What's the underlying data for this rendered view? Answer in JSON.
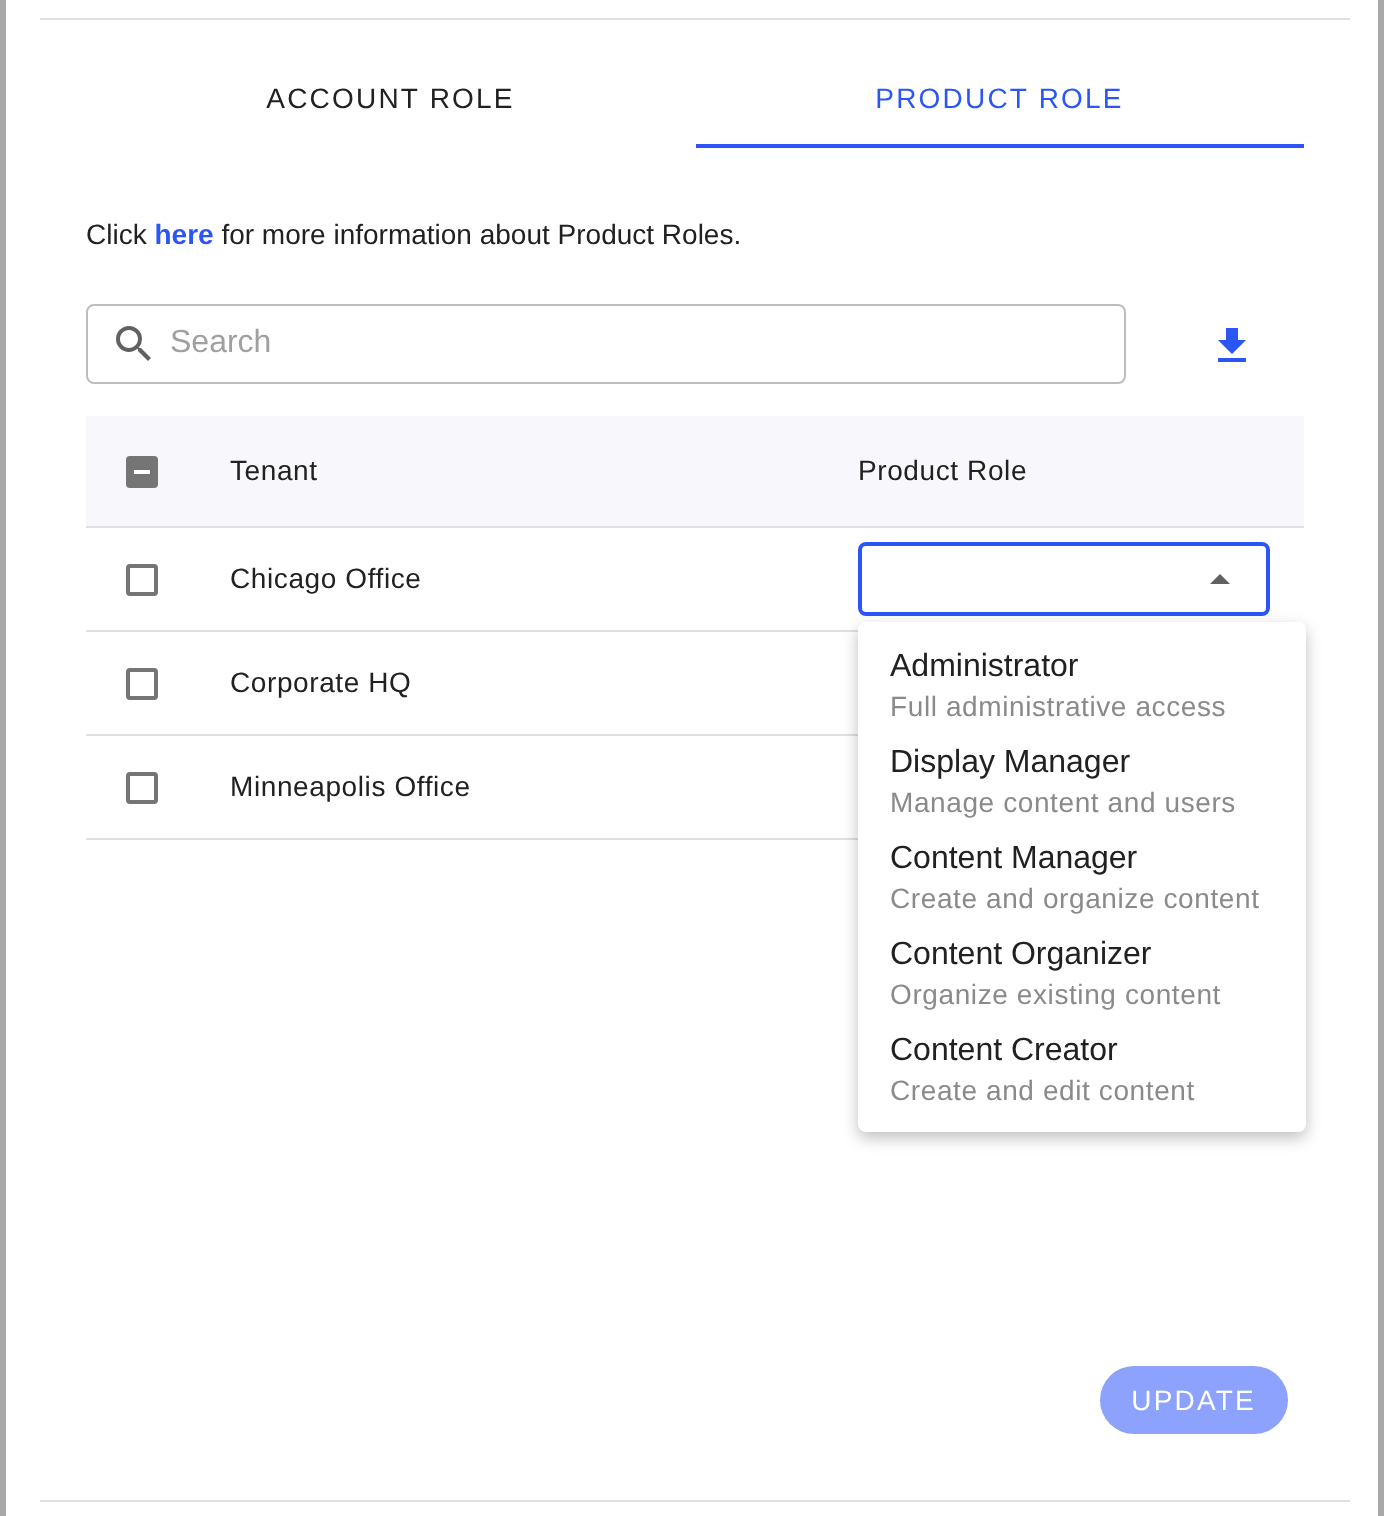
{
  "tabs": [
    {
      "label": "ACCOUNT ROLE",
      "selected": false
    },
    {
      "label": "PRODUCT ROLE",
      "selected": true
    }
  ],
  "info": {
    "prefix": "Click",
    "link": "here",
    "suffix": "for more information about Product Roles."
  },
  "search": {
    "placeholder": "Search"
  },
  "table": {
    "select_all": {
      "indeterminate": true
    },
    "columns": [
      "Tenant",
      "Product Role"
    ],
    "rows": [
      {
        "tenant": "Chicago Office",
        "checked": false,
        "role_select": {
          "expanded": true,
          "options": [
            {
              "title": "Administrator",
              "description": "Full administrative access"
            },
            {
              "title": "Display Manager",
              "description": "Manage content and users"
            },
            {
              "title": "Content Manager",
              "description": "Create and organize content"
            },
            {
              "title": "Content Organizer",
              "description": "Organize existing content"
            },
            {
              "title": "Content Creator",
              "description": "Create and edit content"
            }
          ]
        }
      },
      {
        "tenant": "Corporate HQ",
        "checked": false
      },
      {
        "tenant": "Minneapolis Office",
        "checked": false
      }
    ]
  },
  "update_button": {
    "label": "UPDATE",
    "disabled": true
  }
}
